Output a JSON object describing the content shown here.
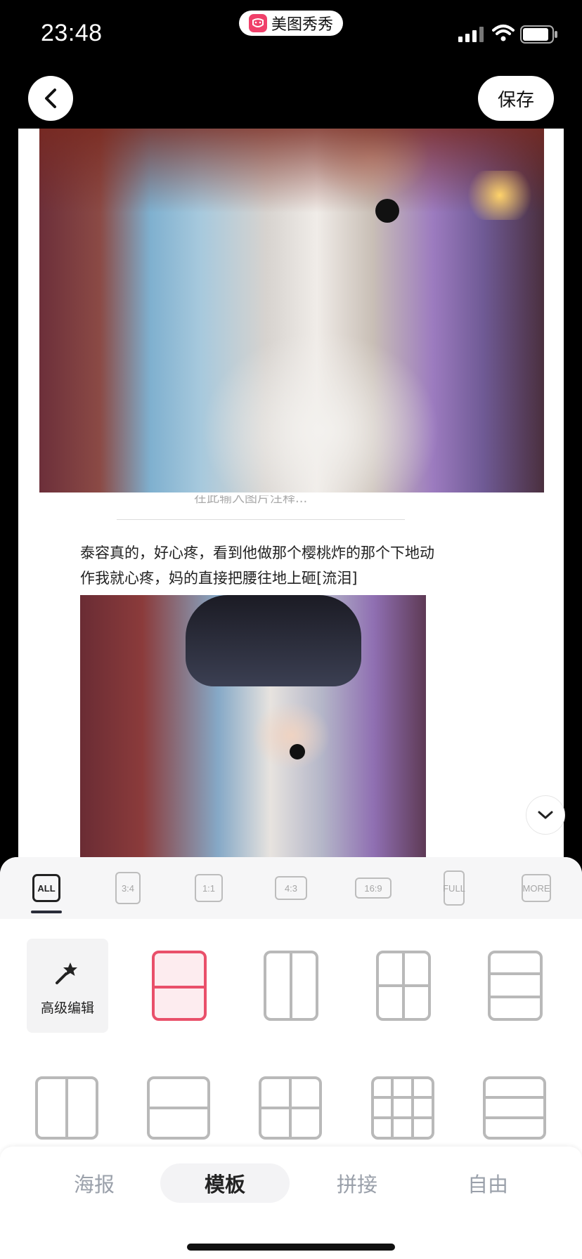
{
  "status_bar": {
    "time": "23:48",
    "app_name": "美图秀秀"
  },
  "nav": {
    "save_label": "保存"
  },
  "content": {
    "caption_partial": "在此输入图片注释...",
    "post_text": "泰容真的，好心疼，看到他做那个樱桃炸的那个下地动作我就心疼，妈的直接把腰往地上砸[流泪]"
  },
  "ratios": [
    {
      "label": "ALL",
      "active": true
    },
    {
      "label": "3:4",
      "active": false
    },
    {
      "label": "1:1",
      "active": false
    },
    {
      "label": "4:3",
      "active": false
    },
    {
      "label": "16:9",
      "active": false
    },
    {
      "label": "FULL",
      "active": false
    },
    {
      "label": "MORE",
      "active": false
    }
  ],
  "advanced_edit_label": "高级编辑",
  "tabs": [
    {
      "label": "海报",
      "active": false
    },
    {
      "label": "模板",
      "active": true
    },
    {
      "label": "拼接",
      "active": false
    },
    {
      "label": "自由",
      "active": false
    }
  ],
  "colors": {
    "accent": "#e9506a",
    "inactive": "#b9b9b9"
  },
  "icons": [
    "back-icon",
    "wand-icon",
    "chevron-down-icon",
    "signal-icon",
    "wifi-icon",
    "battery-icon"
  ]
}
